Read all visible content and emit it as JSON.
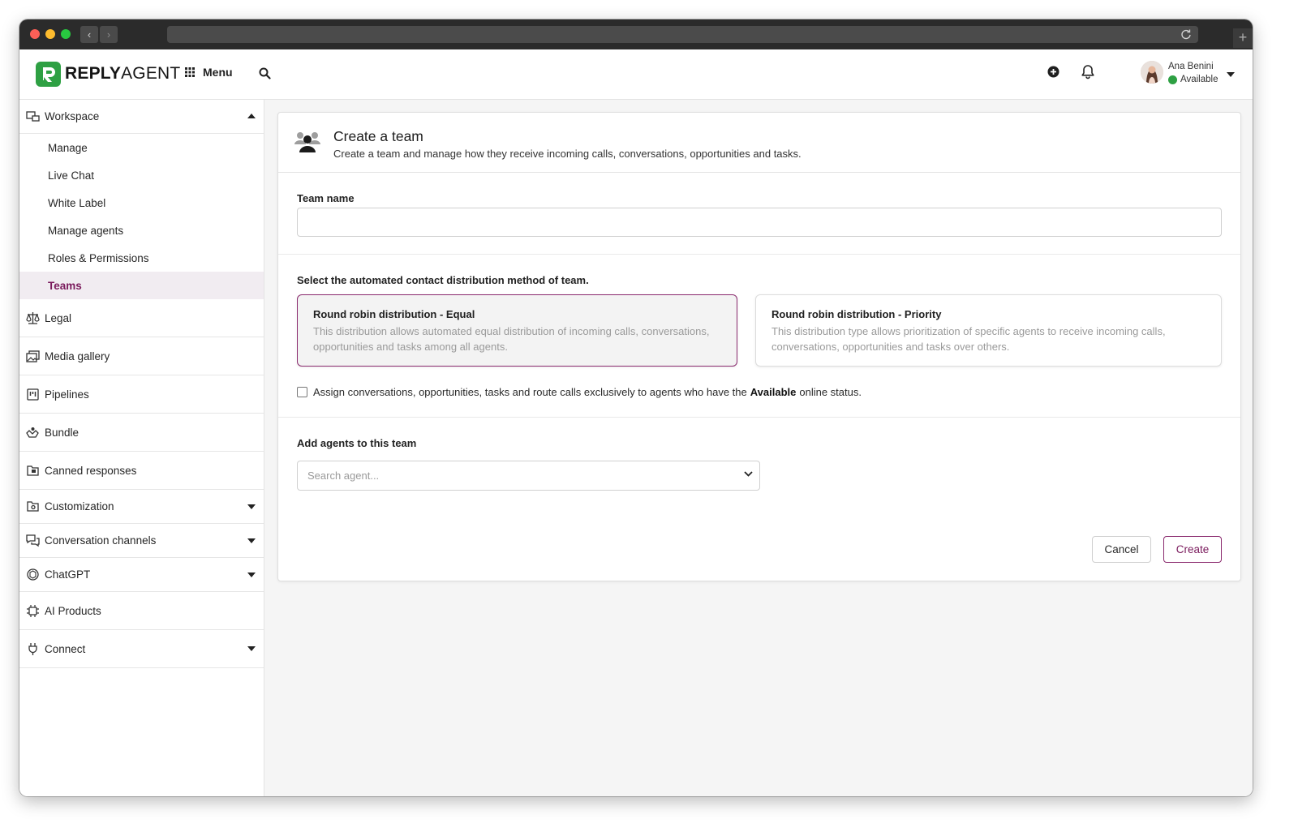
{
  "browser": {
    "back": "‹",
    "forward": "›",
    "new_tab": "+"
  },
  "header": {
    "logo": {
      "bold": "REPLY",
      "regular": "AGENT"
    },
    "menu_label": "Menu",
    "user": {
      "name": "Ana Benini",
      "status": "Available"
    }
  },
  "sidebar": {
    "workspace": {
      "label": "Workspace",
      "items": [
        "Manage",
        "Live Chat",
        "White Label",
        "Manage agents",
        "Roles & Permissions",
        "Teams"
      ],
      "active": "Teams"
    },
    "items": [
      {
        "label": "Legal",
        "icon": "scale-icon"
      },
      {
        "label": "Media gallery",
        "icon": "images-icon"
      },
      {
        "label": "Pipelines",
        "icon": "pipeline-icon"
      },
      {
        "label": "Bundle",
        "icon": "bundle-icon"
      },
      {
        "label": "Canned responses",
        "icon": "canned-responses-icon"
      },
      {
        "label": "Customization",
        "icon": "customization-icon"
      },
      {
        "label": "Conversation channels",
        "icon": "chat-bubbles-icon"
      },
      {
        "label": "ChatGPT",
        "icon": "openai-icon"
      },
      {
        "label": "AI Products",
        "icon": "chip-icon"
      },
      {
        "label": "Connect",
        "icon": "plug-icon"
      }
    ]
  },
  "card": {
    "title": "Create a team",
    "subtitle": "Create a team and manage how they receive incoming calls, conversations, opportunities and tasks.",
    "team_name_label": "Team name",
    "team_name_value": "",
    "distribution_label": "Select the automated contact distribution method of team.",
    "options": [
      {
        "title": "Round robin distribution - Equal",
        "description": "This distribution allows automated equal distribution of incoming calls, conversations, opportunities and tasks among all agents.",
        "selected": true
      },
      {
        "title": "Round robin distribution - Priority",
        "description": "This distribution type allows prioritization of specific agents to receive incoming calls, conversations, opportunities and tasks over others.",
        "selected": false
      }
    ],
    "assign_checkbox": {
      "before": "Assign conversations, opportunities, tasks and route calls exclusively to agents who have the",
      "bold": "Available",
      "after": "online status.",
      "checked": false
    },
    "agents_label": "Add agents to this team",
    "agents_placeholder": "Search agent...",
    "cancel_label": "Cancel",
    "create_label": "Create"
  },
  "colors": {
    "accent": "#8a2a6e",
    "active_bg": "#f1ecf1",
    "status_available": "#2ea043",
    "logo_green": "#2ea043"
  }
}
